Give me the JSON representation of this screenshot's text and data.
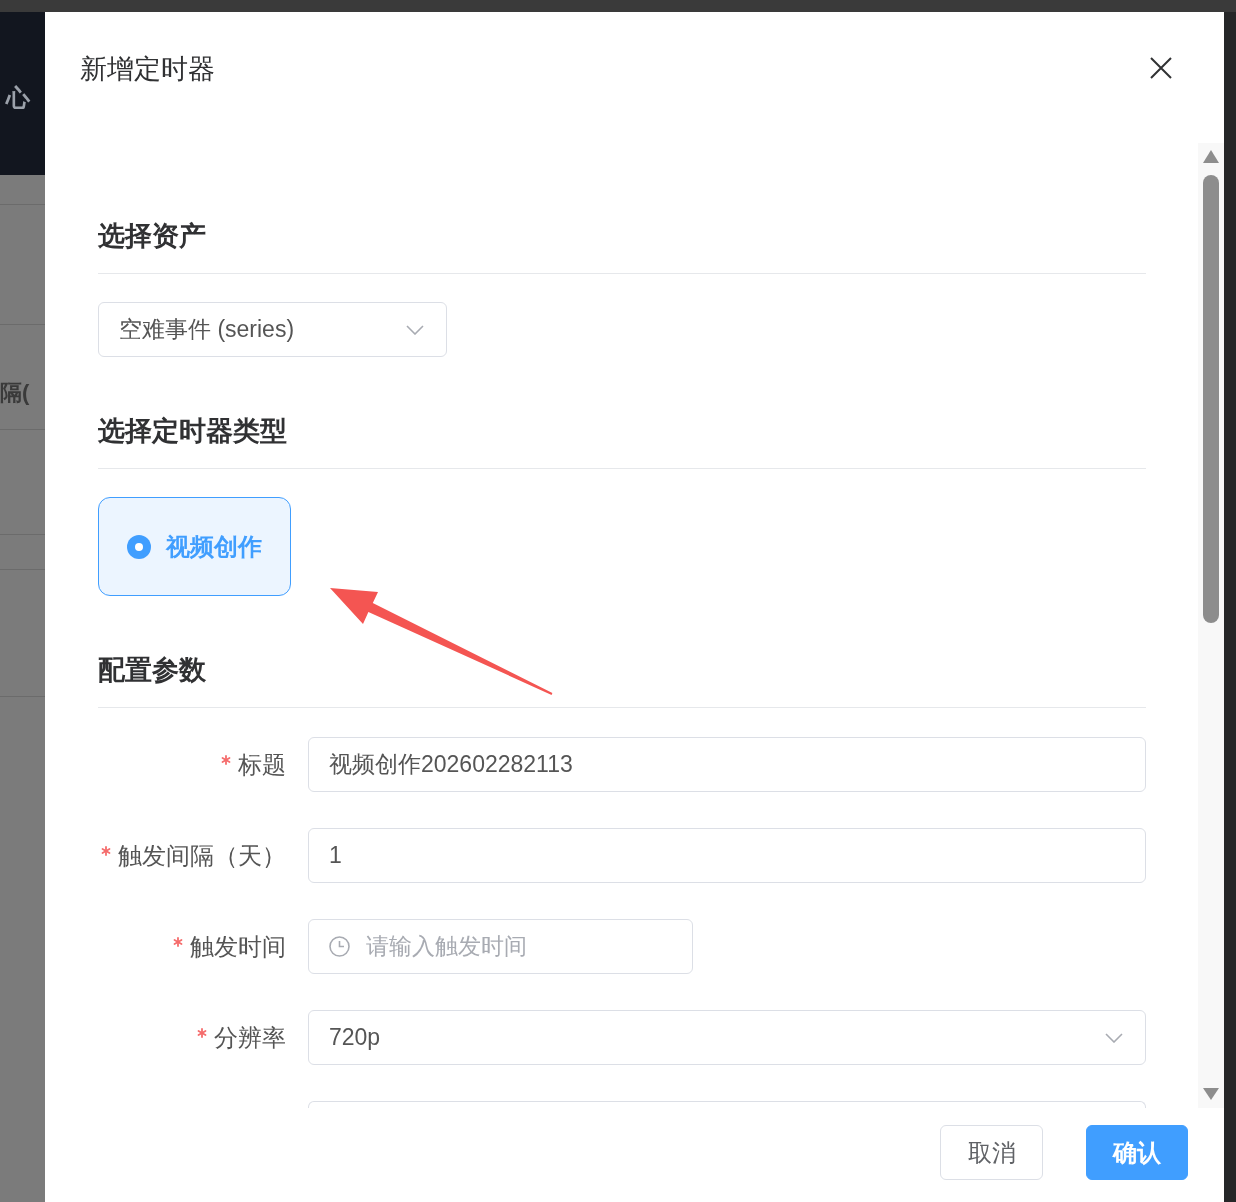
{
  "backdrop": {
    "header_text": "心",
    "row_text": "隔("
  },
  "dialog": {
    "title": "新增定时器"
  },
  "sections": [
    {
      "kind": "select",
      "title": "选择资产",
      "value": "空难事件 (series)"
    },
    {
      "kind": "radio_cards",
      "title": "选择定时器类型",
      "options": [
        {
          "label": "视频创作",
          "selected": true
        }
      ]
    },
    {
      "kind": "form",
      "title": "配置参数",
      "fields": [
        {
          "kind": "text",
          "label": "标题",
          "required": true,
          "value": "视频创作202602282113"
        },
        {
          "kind": "text",
          "label": "触发间隔（天）",
          "required": true,
          "value": "1"
        },
        {
          "kind": "time",
          "label": "触发时间",
          "required": true,
          "placeholder": "请输入触发时间"
        },
        {
          "kind": "select",
          "label": "分辨率",
          "required": true,
          "value": "720p"
        },
        {
          "kind": "cut_off"
        }
      ]
    }
  ],
  "buttons": [
    {
      "kind": "secondary",
      "label": "取消"
    },
    {
      "kind": "primary",
      "label": "确认"
    }
  ]
}
